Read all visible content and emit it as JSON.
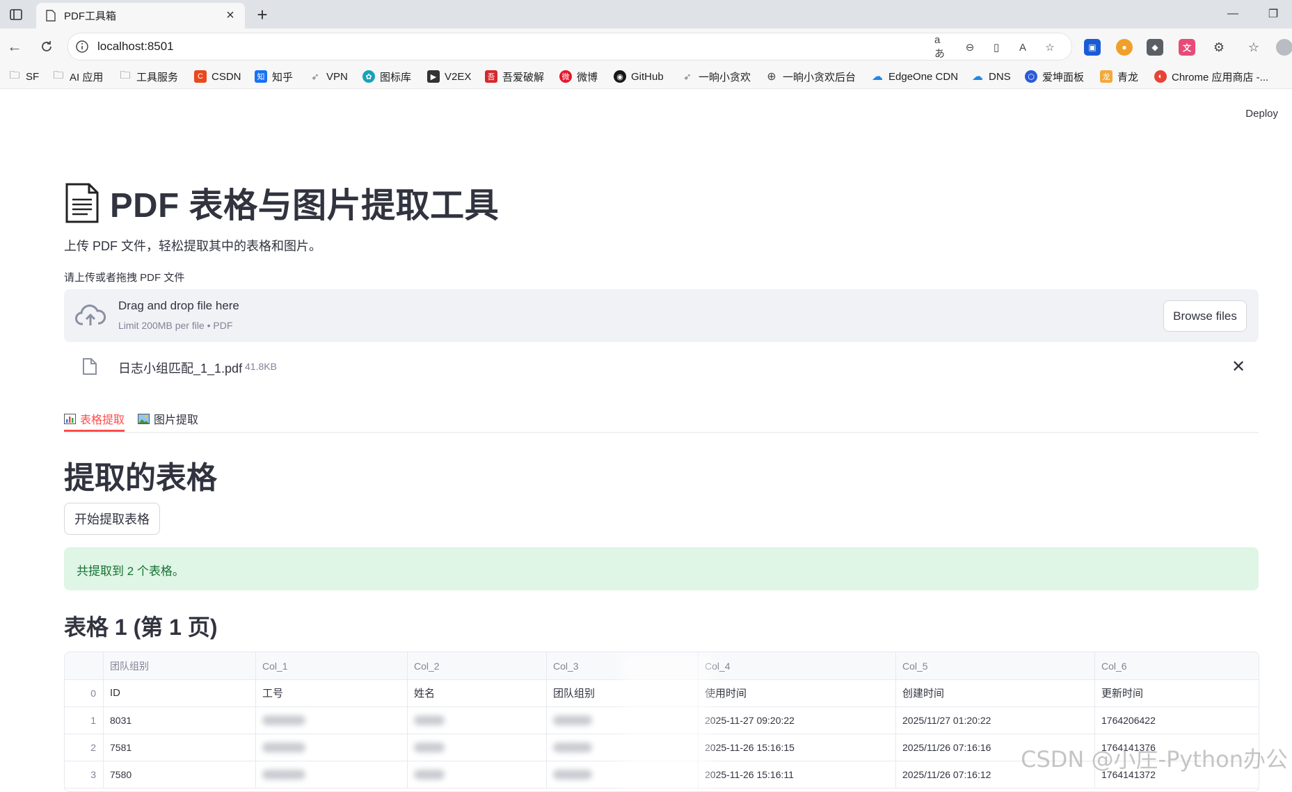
{
  "browser": {
    "tab_title": "PDF工具箱",
    "url": "localhost:8501",
    "bookmarks": [
      "SF",
      "AI 应用",
      "工具服务",
      "CSDN",
      "知乎",
      "VPN",
      "图标库",
      "V2EX",
      "吾爱破解",
      "微博",
      "GitHub",
      "一晌小贪欢",
      "一晌小贪欢后台",
      "EdgeOne CDN",
      "DNS",
      "爱坤面板",
      "青龙",
      "Chrome 应用商店 -..."
    ]
  },
  "header": {
    "deploy": "Deploy"
  },
  "page": {
    "title": "PDF 表格与图片提取工具",
    "subtitle": "上传 PDF 文件，轻松提取其中的表格和图片。"
  },
  "uploader": {
    "label": "请上传或者拖拽 PDF 文件",
    "drop_text": "Drag and drop file here",
    "limit_text": "Limit 200MB per file • PDF",
    "browse_label": "Browse files",
    "file_name": "日志小组匹配_1_1.pdf",
    "file_size": "41.8KB"
  },
  "tabs": [
    {
      "label": "表格提取",
      "active": true
    },
    {
      "label": "图片提取",
      "active": false
    }
  ],
  "section": {
    "heading": "提取的表格",
    "extract_button": "开始提取表格",
    "success_message": "共提取到 2 个表格。",
    "table_heading": "表格 1 (第 1 页)"
  },
  "table": {
    "columns": [
      "",
      "团队组别",
      "Col_1",
      "Col_2",
      "Col_3",
      "Col_4",
      "Col_5",
      "Col_6"
    ],
    "rows": [
      [
        "0",
        "ID",
        "工号",
        "姓名",
        "团队组别",
        "使用时间",
        "创建时间",
        "更新时间"
      ],
      [
        "1",
        "8031",
        "",
        "",
        "",
        "2025-11-27 09:20:22",
        "2025/11/27 01:20:22",
        "1764206422"
      ],
      [
        "2",
        "7581",
        "",
        "",
        "",
        "2025-11-26 15:16:15",
        "2025/11/26 07:16:16",
        "1764141376"
      ],
      [
        "3",
        "7580",
        "",
        "",
        "",
        "2025-11-26 15:16:11",
        "2025/11/26 07:16:12",
        "1764141372"
      ]
    ]
  },
  "watermark": "CSDN @小庄-Python办公",
  "colors": {
    "accent": "#ff4b4b",
    "success_bg": "#dff5e6",
    "success_text": "#177233",
    "text": "#31333f"
  }
}
